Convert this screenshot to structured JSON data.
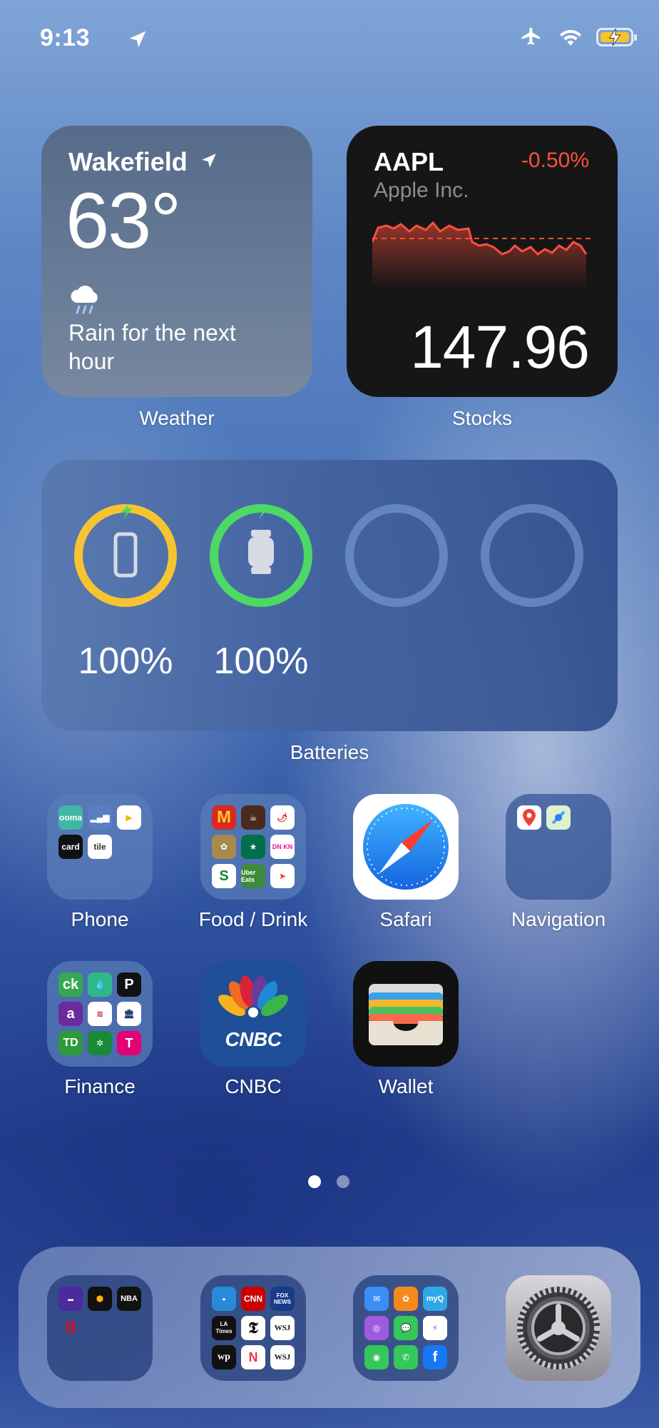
{
  "status_bar": {
    "time": "9:13",
    "icons": [
      "location-arrow-icon",
      "airplane-icon",
      "wifi-icon",
      "battery-charging-icon"
    ]
  },
  "weather_widget": {
    "city": "Wakefield",
    "temperature": "63°",
    "condition": "Rain for the next hour",
    "condition_icon": "rain-cloud-icon",
    "label": "Weather"
  },
  "stocks_widget": {
    "symbol": "AAPL",
    "change": "-0.50%",
    "name": "Apple Inc.",
    "price": "147.96",
    "label": "Stocks",
    "change_color": "#ff4f3d"
  },
  "batteries_widget": {
    "label": "Batteries",
    "devices": [
      {
        "icon": "iphone-icon",
        "percent": "100%",
        "level": 1.0,
        "color": "#f5c430",
        "charging": true
      },
      {
        "icon": "watch-icon",
        "percent": "100%",
        "level": 1.0,
        "color": "#4cd964",
        "charging": true
      },
      {
        "icon": "empty-slot",
        "percent": "",
        "level": 0
      },
      {
        "icon": "empty-slot",
        "percent": "",
        "level": 0
      }
    ]
  },
  "apps": {
    "row1": [
      {
        "label": "Phone",
        "type": "folder"
      },
      {
        "label": "Food / Drink",
        "type": "folder"
      },
      {
        "label": "Safari",
        "type": "app"
      },
      {
        "label": "Navigation",
        "type": "folder"
      }
    ],
    "row2": [
      {
        "label": "Finance",
        "type": "folder"
      },
      {
        "label": "CNBC",
        "type": "app",
        "logo_text": "CNBC"
      },
      {
        "label": "Wallet",
        "type": "app"
      }
    ],
    "phone_folder_minis": {
      "tile": "tile",
      "card": "card"
    },
    "food_folder_minis": {
      "dunkin": "DN KN",
      "uber": "Uber Eats"
    },
    "finance_folder_minis": {
      "ck": "ck",
      "p": "P",
      "a": "a",
      "td": "TD"
    }
  },
  "page_indicator": {
    "pages": 2,
    "current": 1
  },
  "dock": {
    "folders": [
      {
        "name": "sports-folder",
        "minis": {
          "bos": "B",
          "nba": "NBA"
        }
      },
      {
        "name": "news-folder",
        "minis": {
          "cnn": "CNN",
          "fox": "FOX NEWS",
          "la": "LA Times",
          "wsj": "WSJ",
          "wp": "wp"
        }
      },
      {
        "name": "social-folder",
        "minis": {
          "myq": "myQ"
        }
      }
    ],
    "apps": [
      {
        "name": "settings-app"
      }
    ]
  }
}
